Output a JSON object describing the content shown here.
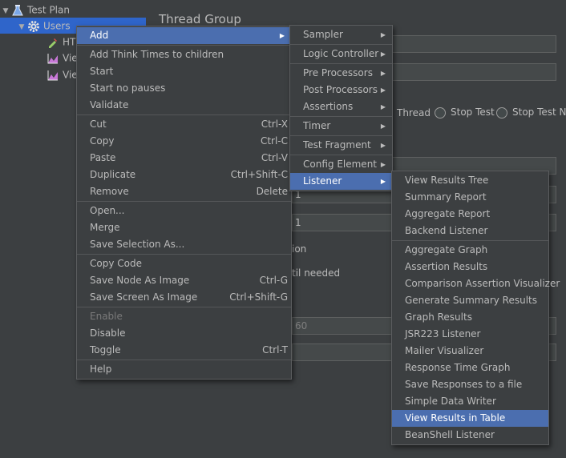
{
  "tree": {
    "items": [
      {
        "label": "Test Plan",
        "icon": "flask-icon"
      },
      {
        "label": "Users",
        "icon": "gear-icon"
      },
      {
        "label": "HT",
        "icon": "pipette-icon"
      },
      {
        "label": "Vie",
        "icon": "graph-icon"
      },
      {
        "label": "Vie",
        "icon": "graph-icon"
      }
    ],
    "divider_glyph": "⋮"
  },
  "editor": {
    "title": "Thread Group",
    "on_error": {
      "thread": "Thread",
      "stop_test": "Stop Test",
      "stop_test_now": "Stop Test Now"
    },
    "fields": {
      "threads_value": "1",
      "loop_value": "1",
      "delay_value": "60"
    },
    "text_fragments": {
      "same_user": "ion",
      "delay_until": "til needed"
    }
  },
  "context_menu": {
    "add": "Add",
    "add_think_times": "Add Think Times to children",
    "start": "Start",
    "start_no_pauses": "Start no pauses",
    "validate": "Validate",
    "cut": {
      "label": "Cut",
      "shortcut": "Ctrl-X"
    },
    "copy": {
      "label": "Copy",
      "shortcut": "Ctrl-C"
    },
    "paste": {
      "label": "Paste",
      "shortcut": "Ctrl-V"
    },
    "duplicate": {
      "label": "Duplicate",
      "shortcut": "Ctrl+Shift-C"
    },
    "remove": {
      "label": "Remove",
      "shortcut": "Delete"
    },
    "open": "Open...",
    "merge": "Merge",
    "save_selection_as": "Save Selection As...",
    "copy_code": "Copy Code",
    "save_node_as_image": {
      "label": "Save Node As Image",
      "shortcut": "Ctrl-G"
    },
    "save_screen_as_image": {
      "label": "Save Screen As Image",
      "shortcut": "Ctrl+Shift-G"
    },
    "enable": "Enable",
    "disable": "Disable",
    "toggle": {
      "label": "Toggle",
      "shortcut": "Ctrl-T"
    },
    "help": "Help"
  },
  "add_submenu": [
    "Sampler",
    "Logic Controller",
    "Pre Processors",
    "Post Processors",
    "Assertions",
    "Timer",
    "Test Fragment",
    "Config Element",
    "Listener"
  ],
  "listener_submenu": {
    "group1": [
      "View Results Tree",
      "Summary Report",
      "Aggregate Report",
      "Backend Listener"
    ],
    "group2": [
      "Aggregate Graph",
      "Assertion Results",
      "Comparison Assertion Visualizer",
      "Generate Summary Results",
      "Graph Results",
      "JSR223 Listener",
      "Mailer Visualizer",
      "Response Time Graph",
      "Save Responses to a file",
      "Simple Data Writer",
      "View Results in Table",
      "BeanShell Listener"
    ],
    "highlighted": "View Results in Table"
  },
  "colors": {
    "background": "#3c3f41",
    "menu_highlight": "#4b6eaf",
    "tree_selection": "#2f65ca",
    "text": "#bbbbbb"
  }
}
